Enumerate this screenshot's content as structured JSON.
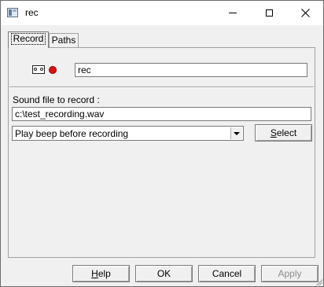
{
  "window": {
    "title": "rec"
  },
  "tabs": [
    {
      "label": "Record",
      "active": true
    },
    {
      "label": "Paths",
      "active": false
    }
  ],
  "record": {
    "icons": [
      "tape-icon",
      "record-dot-icon"
    ],
    "name_value": "rec",
    "sound_label": "Sound file to record :",
    "sound_path": "c:\\test_recording.wav",
    "beep_selected": "Play beep before recording",
    "select_label": {
      "pre": "",
      "key": "S",
      "post": "elect"
    }
  },
  "buttons": {
    "help": {
      "pre": "",
      "key": "H",
      "post": "elp"
    },
    "ok": "OK",
    "cancel": "Cancel",
    "apply": "Apply"
  },
  "colors": {
    "record_dot": "#e01010",
    "disabled_text": "#8d8d8d"
  }
}
